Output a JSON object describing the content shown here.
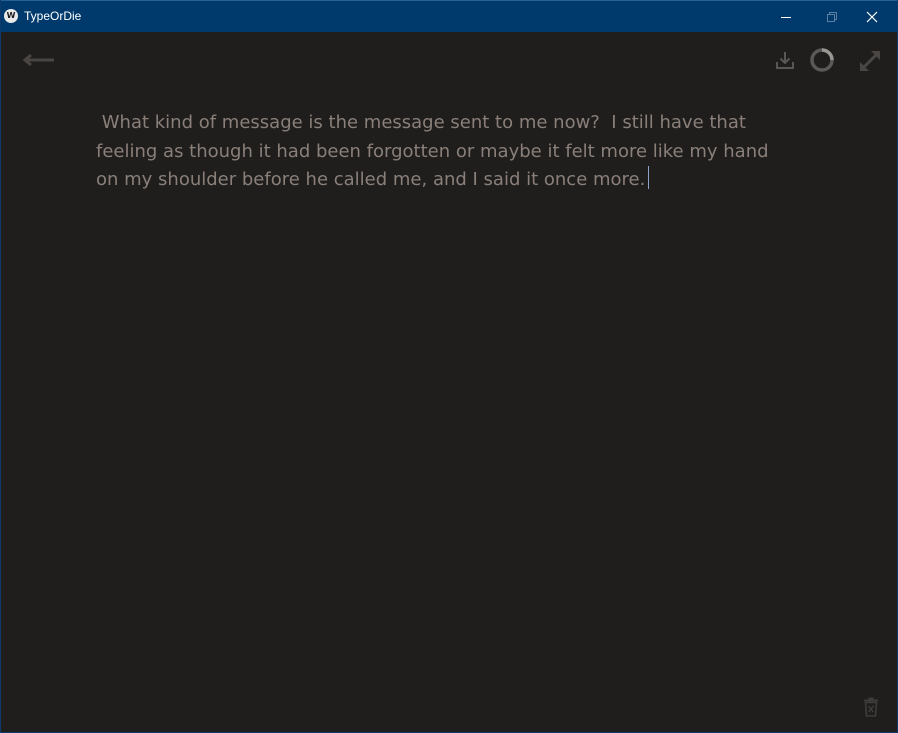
{
  "window": {
    "title": "TypeOrDie",
    "app_icon_glyph": "W",
    "titlebar_color": "#003a6d",
    "background_color": "#1f1e1d"
  },
  "toolbar": {
    "back_icon": "arrow-left-icon",
    "download_icon": "download-icon",
    "timer_icon": "timer-ring-icon",
    "fullscreen_icon": "expand-icon"
  },
  "editor": {
    "text": " What kind of message is the message sent to me now?  I still have that feeling as though it had been forgotten or maybe it felt more like my hand on my shoulder before he called me, and I said it once more.",
    "text_color": "#8a7f79"
  },
  "footer": {
    "delete_icon": "trash-icon"
  }
}
